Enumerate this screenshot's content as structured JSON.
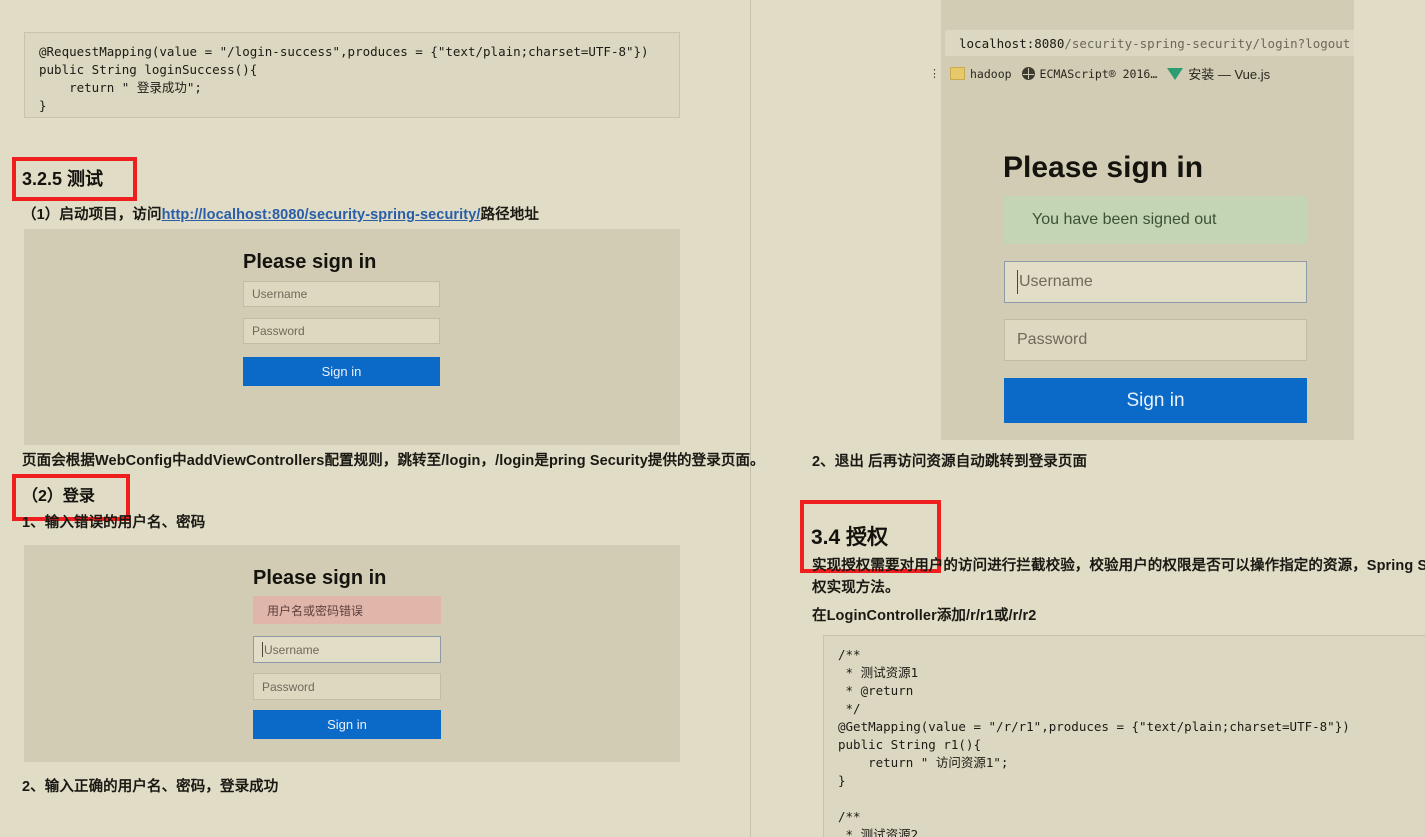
{
  "document": {
    "left_column": {
      "code_block_1": "@RequestMapping(value = \"/login-success\",produces = {\"text/plain;charset=UTF-8\"})\npublic String loginSuccess(){\n    return \" 登录成功\";\n}",
      "heading_325": "3.2.5 测试",
      "step_1_prefix": "（1）启动项目，访问",
      "step_1_link": "http://localhost:8080/security-spring-security/",
      "step_1_suffix": "路径地址",
      "paragraph_after_form": "页面会根据WebConfig中addViewControllers配置规则，跳转至/login，/login是pring Security提供的登录页面。",
      "heading_2_login": "（2）登录",
      "bullet_1": "1、输入错误的用户名、密码",
      "bullet_2": "2、输入正确的用户名、密码，登录成功"
    },
    "right_column": {
      "bullet_logout": "2、退出 后再访问资源自动跳转到登录页面",
      "heading_34": "3.4 授权",
      "paragraph_line_1": "实现授权需要对用户的访问进行拦截校验，校验用户的权限是否可以操作指定的资源，Spring Security默认",
      "paragraph_line_2": "权实现方法。",
      "paragraph_line_3": "在LoginController添加/r/r1或/r/r2",
      "code_block_2": "/**\n * 测试资源1\n * @return\n */\n@GetMapping(value = \"/r/r1\",produces = {\"text/plain;charset=UTF-8\"})\npublic String r1(){\n    return \" 访问资源1\";\n}\n\n/**\n * 测试资源2"
    }
  },
  "screenshot_login_plain": {
    "title": "Please sign in",
    "username_placeholder": "Username",
    "password_placeholder": "Password",
    "signin_label": "Sign in"
  },
  "screenshot_login_error": {
    "title": "Please sign in",
    "error_message": "用户名或密码错误",
    "username_placeholder": "Username",
    "password_placeholder": "Password",
    "signin_label": "Sign in"
  },
  "screenshot_login_signedout": {
    "browser": {
      "url_host": "localhost:8080",
      "url_path": "/security-spring-security/login?logout",
      "bookmarks": [
        {
          "icon": "folder-icon",
          "label": "hadoop"
        },
        {
          "icon": "globe-icon",
          "label": "ECMAScript® 2016…"
        },
        {
          "icon": "vue-icon",
          "label": "安装 — Vue.js"
        }
      ]
    },
    "title": "Please sign in",
    "success_message": "You have been signed out",
    "username_placeholder": "Username",
    "password_placeholder": "Password",
    "signin_label": "Sign in"
  },
  "annotations": {
    "color": "#ef1f1f",
    "boxes": [
      {
        "name": "redbox-heading-325"
      },
      {
        "name": "redbox-heading-2-login"
      },
      {
        "name": "redbox-heading-34"
      }
    ]
  },
  "theme": {
    "page_background": "#e0dcc6",
    "screenshot_background": "#d1ccb3",
    "primary_button": "#0b69c7",
    "error_alert": "#e0b6ab",
    "success_alert": "#c3d5b2",
    "annotation_red": "#ef1f1f"
  }
}
